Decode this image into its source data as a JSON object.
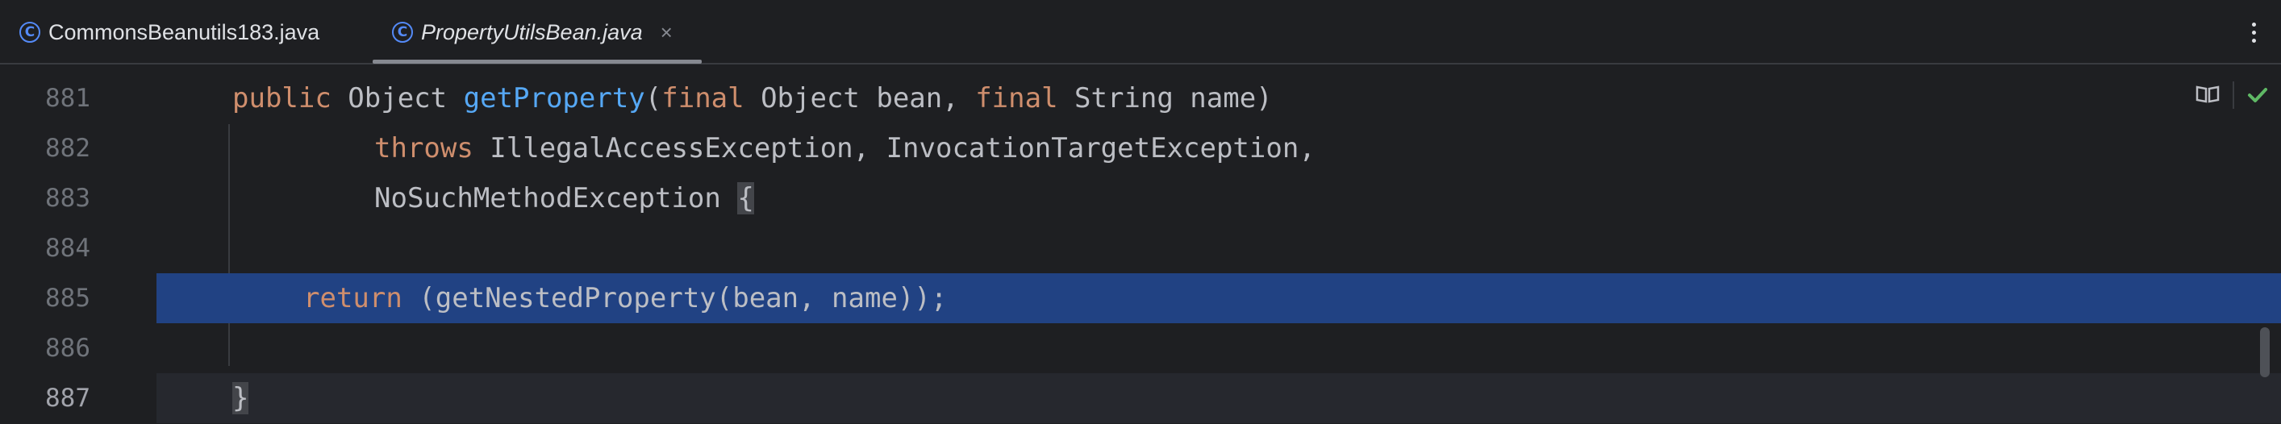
{
  "tabs": [
    {
      "label": "CommonsBeanutils183.java",
      "icon": "class-icon",
      "active": false
    },
    {
      "label": "PropertyUtilsBean.java",
      "icon": "class-icon",
      "active": true
    }
  ],
  "tab_close_glyph": "×",
  "tab_icon_glyph": "C",
  "editor": {
    "lines": [
      {
        "number": "881"
      },
      {
        "number": "882"
      },
      {
        "number": "883"
      },
      {
        "number": "884"
      },
      {
        "number": "885"
      },
      {
        "number": "886"
      },
      {
        "number": "887"
      }
    ],
    "tokens": {
      "l881_public": "public",
      "l881_object": " Object ",
      "l881_method": "getProperty",
      "l881_paren": "(",
      "l881_final1": "final",
      "l881_p1": " Object bean, ",
      "l881_final2": "final",
      "l881_p2": " String name)",
      "l882_throws": "throws",
      "l882_rest": " IllegalAccessException, InvocationTargetException,",
      "l883_ex": "NoSuchMethodException ",
      "l883_brace": "{",
      "l885_return": "return",
      "l885_rest": " (getNestedProperty(bean, name));",
      "l887_brace": "}"
    },
    "highlighted_line": "885",
    "current_line": "887"
  },
  "colors": {
    "background": "#1e1f22",
    "keyword": "#cf8e6d",
    "method": "#56a8f5",
    "selection": "#214283",
    "icon_accent": "#548af7",
    "check": "#5fb865"
  },
  "icons": [
    "class-icon",
    "close-icon",
    "more-icon",
    "reader-mode-icon",
    "check-icon"
  ]
}
